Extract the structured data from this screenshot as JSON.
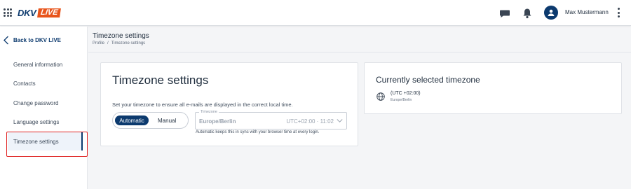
{
  "header": {
    "logo_text": "DKV",
    "logo_badge": "LIVE",
    "username": "Max Mustermann",
    "icons": [
      "apps-grid-icon",
      "chat-icon",
      "bell-icon",
      "user-icon",
      "more-vert-icon"
    ],
    "colors": {
      "brand_blue": "#0c3a6e",
      "brand_orange": "#e8541b"
    }
  },
  "sidebar": {
    "back_label": "Back to DKV LIVE",
    "items": [
      {
        "label": "General information"
      },
      {
        "label": "Contacts"
      },
      {
        "label": "Change password"
      },
      {
        "label": "Language settings"
      },
      {
        "label": "Timezone settings",
        "active": true
      }
    ],
    "highlight_color": "#e02424"
  },
  "page": {
    "title": "Timezone settings",
    "breadcrumb": [
      "Profile",
      "/",
      "Timezone settings"
    ]
  },
  "timezone_card": {
    "heading": "Timezone settings",
    "description": "Set your timezone to ensure all e-mails are displayed in the correct local time.",
    "toggle": {
      "options": [
        "Automatic",
        "Manual"
      ],
      "selected": "Automatic"
    },
    "field": {
      "legend": "Timezone",
      "value": "Europe/Berlin",
      "offset": "UTC+02:00 · 11:02"
    },
    "hint": "Automatic keeps this in sync with your browser time at every login."
  },
  "current_card": {
    "heading": "Currently selected timezone",
    "offset": "(UTC +02:00)",
    "zone": "Europe/Berlin"
  }
}
